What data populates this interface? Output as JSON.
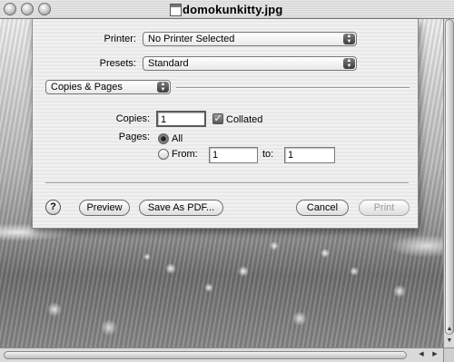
{
  "window": {
    "title": "domokunkitty.jpg",
    "traffic_lights": [
      "close-button",
      "minimize-button",
      "zoom-button"
    ]
  },
  "print_dialog": {
    "printer_label": "Printer:",
    "printer_value": "No Printer Selected",
    "presets_label": "Presets:",
    "presets_value": "Standard",
    "pane_value": "Copies & Pages",
    "copies_label": "Copies:",
    "copies_value": "1",
    "collated_label": "Collated",
    "collated_checked": true,
    "pages_label": "Pages:",
    "all_label": "All",
    "from_label": "From:",
    "from_value": "1",
    "to_label": "to:",
    "to_value": "1",
    "pages_selected": "All",
    "help_label": "?",
    "preview_label": "Preview",
    "save_pdf_label": "Save As PDF...",
    "cancel_label": "Cancel",
    "print_label": "Print",
    "print_enabled": false
  },
  "scrollbars": {
    "up_arrow": "▲",
    "down_arrow": "▼",
    "left_arrow": "◀",
    "right_arrow": "▶"
  }
}
